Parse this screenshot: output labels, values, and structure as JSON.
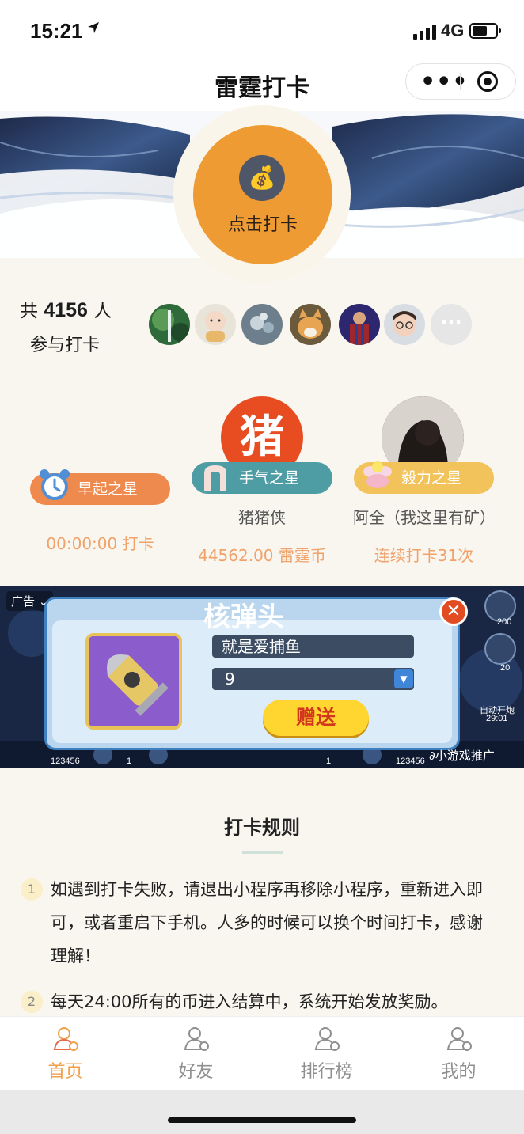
{
  "status_bar": {
    "time": "15:21",
    "network": "4G"
  },
  "nav": {
    "title": "雷霆打卡"
  },
  "checkin": {
    "label": "点击打卡",
    "icon": "money-bag-icon"
  },
  "participants": {
    "prefix": "共 ",
    "count": "4156",
    "suffix": " 人",
    "line2": "参与打卡",
    "more": "···"
  },
  "stars": [
    {
      "badge": "早起之星",
      "name": "",
      "stat": "00:00:00 打卡"
    },
    {
      "badge": "手气之星",
      "name": "猪猪侠",
      "stat": "44562.00 雷霆币",
      "avatar_text": "猪"
    },
    {
      "badge": "毅力之星",
      "name": "阿全（我这里有矿）",
      "stat": "连续打卡31次"
    }
  ],
  "ad": {
    "tag": "广告",
    "title": "核弹头",
    "input_value": "就是爱捕鱼",
    "select_value": "9",
    "gift_button": "赠送",
    "source": "小游戏推广",
    "side_values": [
      "200",
      "20",
      "自动开炮",
      "29:01"
    ],
    "bottom_values": [
      "123456",
      "1",
      "1",
      "123456"
    ]
  },
  "rules": {
    "title": "打卡规则",
    "items": [
      {
        "num": "1",
        "text": "如遇到打卡失败，请退出小程序再移除小程序，重新进入即可，或者重启下手机。人多的时候可以换个时间打卡，感谢理解！"
      },
      {
        "num": "2",
        "text": "每天24:00所有的币进入结算中，系统开始发放奖励。"
      }
    ]
  },
  "tabs": [
    {
      "label": "首页",
      "active": true
    },
    {
      "label": "好友",
      "active": false
    },
    {
      "label": "排行榜",
      "active": false
    },
    {
      "label": "我的",
      "active": false
    }
  ],
  "colors": {
    "accent_orange": "#ef9b33",
    "pill_orange": "#ef8a4f",
    "pill_teal": "#4e9da5",
    "pill_yellow": "#f2c35a",
    "stat_orange": "#f1a26a",
    "tab_active": "#f0a04b",
    "tab_inactive": "#8f8f8f"
  }
}
